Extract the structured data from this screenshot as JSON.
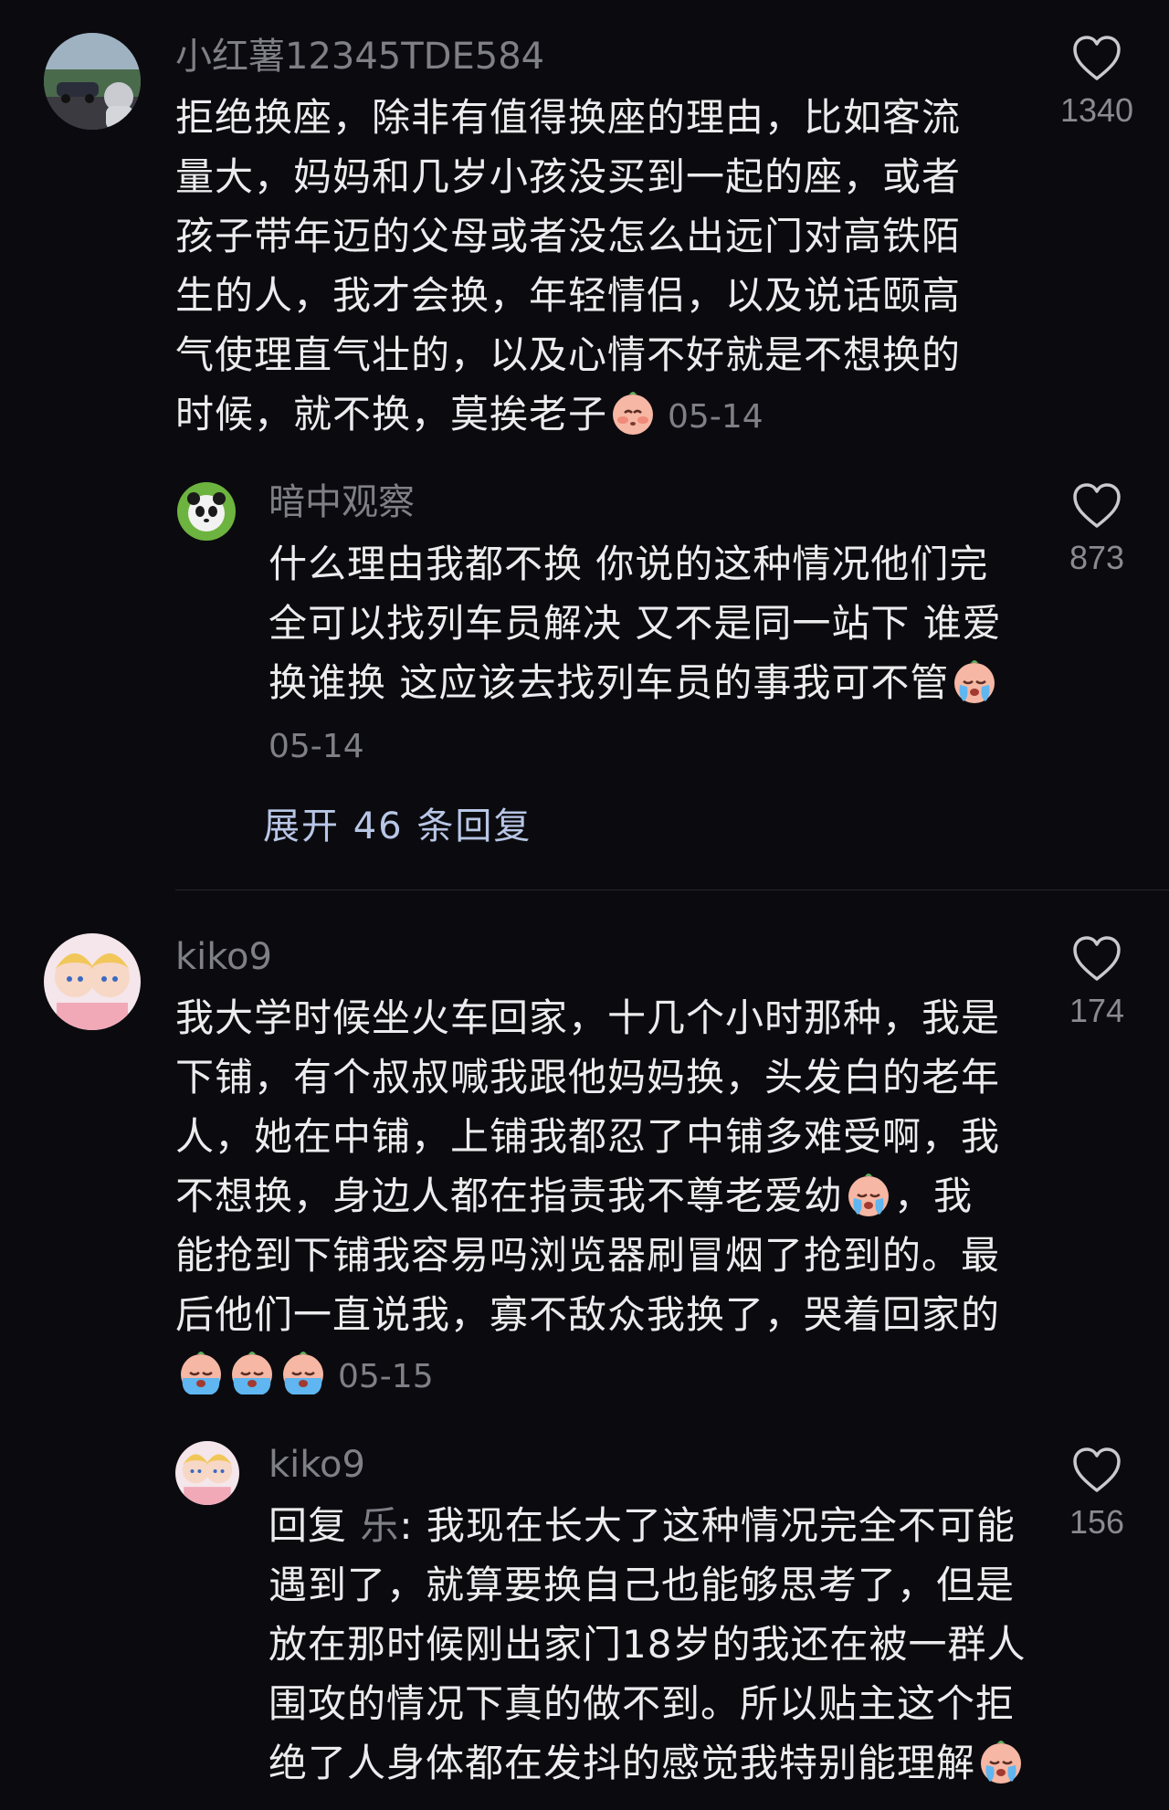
{
  "comments": [
    {
      "username": "小红薯12345TDE584",
      "text": "拒绝换座，除非有值得换座的理由，比如客流量大，妈妈和几岁小孩没买到一起的座，或者孩子带年迈的父母或者没怎么出远门对高铁陌生的人，我才会换，年轻情侣，以及说话颐高气使理直气壮的，以及心情不好就是不想换的时候，就不换，莫挨老子",
      "date": "05-14",
      "likes": "1340"
    },
    {
      "username": "暗中观察",
      "text": "什么理由我都不换 你说的这种情况他们完全可以找列车员解决 又不是同一站下 谁爱换谁换 这应该去找列车员的事我可不管",
      "date": "05-14",
      "likes": "873"
    },
    {
      "username": "kiko9",
      "text_part1": "我大学时候坐火车回家，十几个小时那种，我是下铺，有个叔叔喊我跟他妈妈换，头发白的老年人，她在中铺，上铺我都忍了中铺多难受啊，我不想换，身边人都在指责我不尊老爱幼",
      "text_part2": "，我能抢到下铺我容易吗浏览器刷冒烟了抢到的。最后他们一直说我，寡不敌众我换了，哭着回家的",
      "date": "05-15",
      "likes": "174"
    },
    {
      "username": "kiko9",
      "reply_prefix": "回复",
      "reply_target": "乐",
      "text": ": 我现在长大了这种情况完全不可能遇到了，就算要换自己也能够思考了，但是放在那时候刚出家门18岁的我还在被一群人围攻的情况下真的做不到。所以贴主这个拒绝了人身体都在发抖的感觉我特别能理解",
      "likes": "156"
    }
  ],
  "expand_replies": "展开 46 条回复",
  "icons": {
    "like": "heart-outline-icon",
    "emoji_blush": "blushing-face-emoji-icon",
    "emoji_cry": "crying-face-emoji-icon"
  },
  "colors": {
    "background": "#0b0b0f",
    "text": "#ececee",
    "muted": "#7f7f86",
    "link": "#b8c6e6"
  }
}
